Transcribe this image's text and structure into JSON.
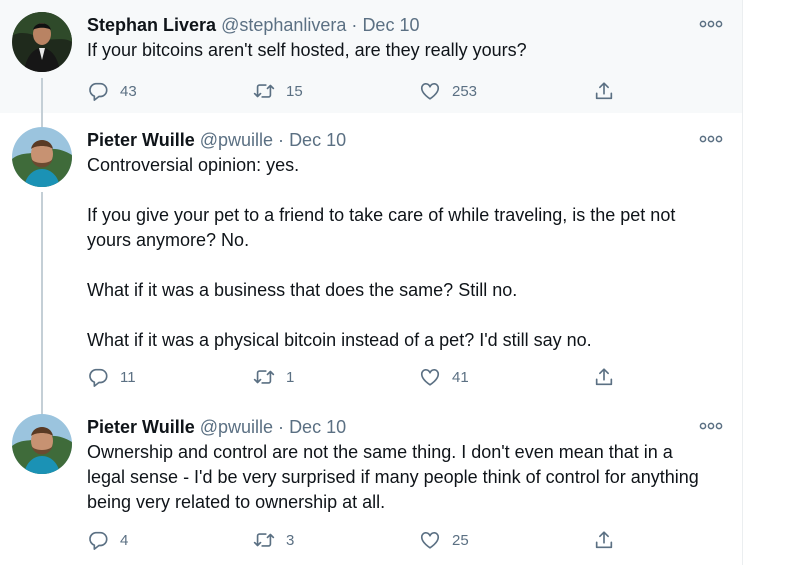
{
  "tweets": [
    {
      "name": "Stephan Livera",
      "handle": "@stephanlivera",
      "separator": "·",
      "date": "Dec 10",
      "paragraphs": [
        "If your bitcoins aren't self hosted, are they really yours?"
      ],
      "replies": "43",
      "retweets": "15",
      "likes": "253"
    },
    {
      "name": "Pieter Wuille",
      "handle": "@pwuille",
      "separator": "·",
      "date": "Dec 10",
      "paragraphs": [
        "Controversial opinion: yes.",
        "If you give your pet to a friend to take care of while traveling, is the pet not yours anymore? No.",
        "What if it was a business that does the same? Still no.",
        "What if it was a physical bitcoin instead of a pet? I'd still say no."
      ],
      "replies": "11",
      "retweets": "1",
      "likes": "41"
    },
    {
      "name": "Pieter Wuille",
      "handle": "@pwuille",
      "separator": "·",
      "date": "Dec 10",
      "paragraphs": [
        "Ownership and control are not the same thing. I don't even mean that in a legal sense - I'd be very surprised if many people think of control for anything being very related to ownership at all."
      ],
      "replies": "4",
      "retweets": "3",
      "likes": "25"
    }
  ],
  "icons": {
    "reply": "reply-icon",
    "retweet": "retweet-icon",
    "like": "heart-icon",
    "share": "share-icon",
    "more": "more-icon"
  },
  "colors": {
    "text": "#0f1419",
    "secondary": "#5b7083",
    "thread_line": "#c4cfd6",
    "highlight_bg": "#f7f9fa"
  }
}
